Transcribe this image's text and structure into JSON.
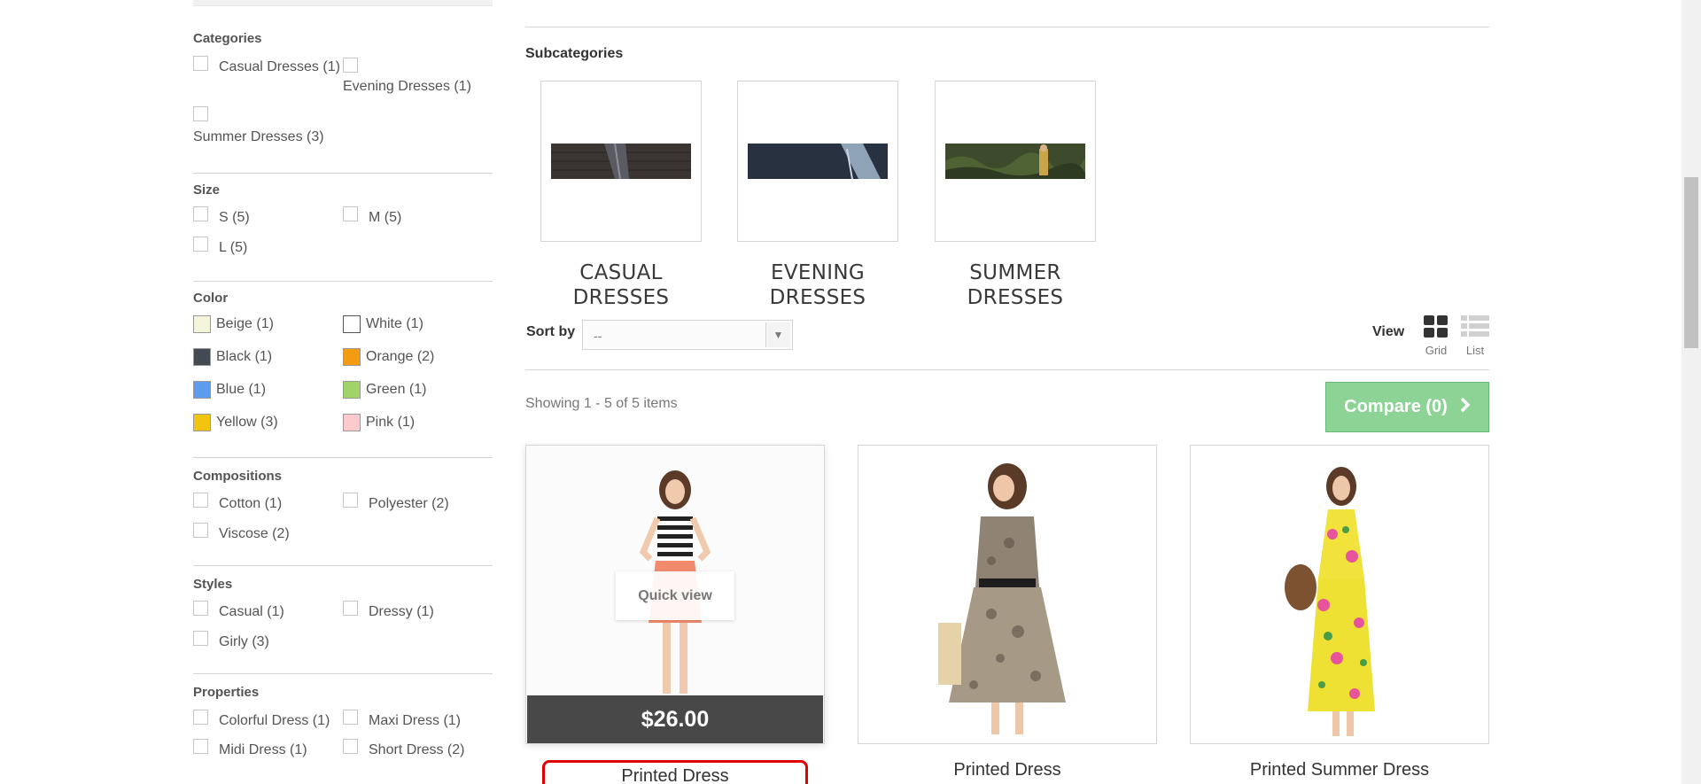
{
  "sidebar": {
    "categories": {
      "title": "Categories",
      "items": [
        "Casual Dresses (1)",
        "Evening Dresses (1)",
        "Summer Dresses (3)"
      ]
    },
    "size": {
      "title": "Size",
      "items": [
        "S (5)",
        "M (5)",
        "L (5)"
      ]
    },
    "color": {
      "title": "Color",
      "items": [
        {
          "label": "Beige (1)",
          "color": "#f5f5dc"
        },
        {
          "label": "White (1)",
          "color": "#ffffff"
        },
        {
          "label": "Black (1)",
          "color": "#434a54"
        },
        {
          "label": "Orange (2)",
          "color": "#f39c11"
        },
        {
          "label": "Blue (1)",
          "color": "#5d9cec"
        },
        {
          "label": "Green (1)",
          "color": "#a0d468"
        },
        {
          "label": "Yellow (3)",
          "color": "#f1c40f"
        },
        {
          "label": "Pink (1)",
          "color": "#fccacd"
        }
      ]
    },
    "compositions": {
      "title": "Compositions",
      "items": [
        "Cotton (1)",
        "Polyester (2)",
        "Viscose (2)"
      ]
    },
    "styles": {
      "title": "Styles",
      "items": [
        "Casual (1)",
        "Dressy (1)",
        "Girly (3)"
      ]
    },
    "properties": {
      "title": "Properties",
      "items": [
        "Colorful Dress (1)",
        "Maxi Dress (1)",
        "Midi Dress (1)",
        "Short Dress (2)"
      ]
    }
  },
  "main": {
    "subcategories_title": "Subcategories",
    "subcategories": [
      {
        "line1": "CASUAL",
        "line2": "DRESSES"
      },
      {
        "line1": "EVENING",
        "line2": "DRESSES"
      },
      {
        "line1": "SUMMER",
        "line2": "DRESSES"
      }
    ],
    "sort_label": "Sort by",
    "sort_value": "--",
    "view_label": "View",
    "view_grid": "Grid",
    "view_list": "List",
    "showing": "Showing 1 - 5 of 5 items",
    "compare_label": "Compare (0)",
    "quick_view": "Quick view",
    "products": [
      {
        "name": "Printed Dress",
        "price": "$26.00"
      },
      {
        "name": "Printed Dress"
      },
      {
        "name": "Printed Summer Dress"
      }
    ]
  }
}
